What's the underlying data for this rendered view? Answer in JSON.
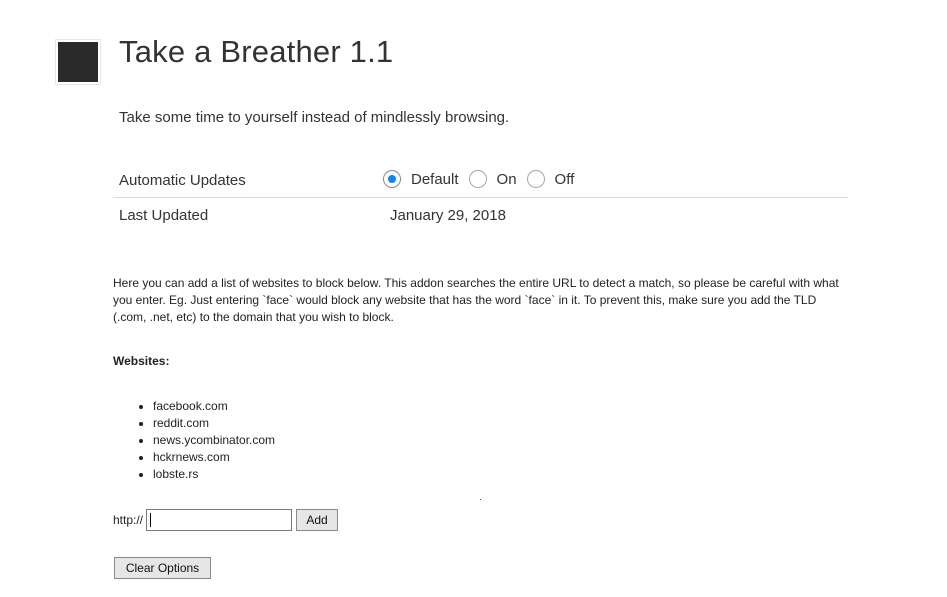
{
  "addon": {
    "title": "Take a Breather 1.1",
    "description": "Take some time to yourself instead of mindlessly browsing."
  },
  "prefs": {
    "auto_updates": {
      "label": "Automatic Updates",
      "options": [
        "Default",
        "On",
        "Off"
      ],
      "selected": "Default"
    },
    "last_updated": {
      "label": "Last Updated",
      "value": "January 29, 2018"
    }
  },
  "options_page": {
    "intro": "Here you can add a list of websites to block below. This addon searches the entire URL to detect a match, so please be careful with what you enter. Eg. Just entering `face` would block any website that has the word `face` in it. To prevent this, make sure you add the TLD (.com, .net, etc) to the domain that you wish to block.",
    "websites_label": "Websites:",
    "websites": [
      "facebook.com",
      "reddit.com",
      "news.ycombinator.com",
      "hckrnews.com",
      "lobste.rs"
    ],
    "url_prefix": "http://",
    "input_value": "",
    "add_label": "Add",
    "clear_label": "Clear Options"
  },
  "colors": {
    "accent": "#0a84ff",
    "icon": "#2b2b2b"
  }
}
